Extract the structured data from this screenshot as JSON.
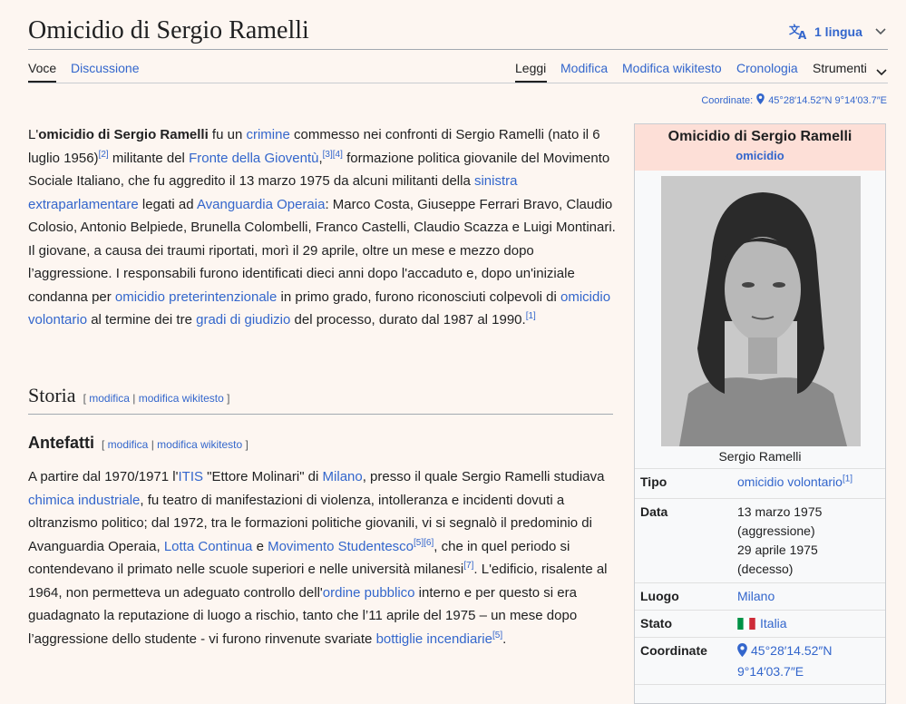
{
  "page": {
    "title": "Omicidio di Sergio Ramelli",
    "language_button": "1 lingua",
    "colors": {
      "link": "#3366cc",
      "infobox_header": "#fddfd7",
      "background": "#fdf6f1"
    }
  },
  "tabs": {
    "left": [
      "Voce",
      "Discussione"
    ],
    "right": [
      "Leggi",
      "Modifica",
      "Modifica wikitesto",
      "Cronologia",
      "Strumenti"
    ]
  },
  "coordinates_line": {
    "label": "Coordinate:",
    "value": "45°28′14.52″N 9°14′03.7″E"
  },
  "intro": {
    "t1": "L'",
    "bold": "omicidio di Sergio Ramelli",
    "t2": " fu un ",
    "l1": "crimine",
    "t3": " commesso nei confronti di Sergio Ramelli (nato il 6 luglio 1956)",
    "r1": "[2]",
    "t4": " militante del ",
    "l2": "Fronte della Gioventù",
    "t4b": ",",
    "r2": "[3][4]",
    "t5": " formazione politica giovanile del Movimento Sociale Italiano, che fu aggredito il 13 marzo 1975 da alcuni militanti della ",
    "l3": "sinistra extraparlamentare",
    "t6": " legati ad ",
    "l4": "Avanguardia Operaia",
    "t7": ": Marco Costa, Giuseppe Ferrari Bravo, Claudio Colosio, Antonio Belpiede, Brunella Colombelli, Franco Castelli, Claudio Scazza e Luigi Montinari. Il giovane, a causa dei traumi riportati, morì il 29 aprile, oltre un mese e mezzo dopo l’aggressione. I responsabili furono identificati dieci anni dopo l'accaduto e, dopo un'iniziale condanna per ",
    "l5": "omicidio preterintenzionale",
    "t8": " in primo grado, furono riconosciuti colpevoli di ",
    "l6": "omicidio volontario",
    "t9": " al termine dei tre ",
    "l7": "gradi di giudizio",
    "t10": " del processo, durato dal 1987 al 1990.",
    "r3": "[1]"
  },
  "sections": {
    "storia": "Storia",
    "antefatti": "Antefatti",
    "edit_open": "[ ",
    "edit_modifica": "modifica",
    "edit_sep": " | ",
    "edit_wikitesto": "modifica wikitesto",
    "edit_close": " ]"
  },
  "body": {
    "t1": "A partire dal 1970/1971 l'",
    "l1": "ITIS",
    "t2": " \"Ettore Molinari\" di ",
    "l2": "Milano",
    "t3": ", presso il quale Sergio Ramelli studiava ",
    "l3": "chimica industriale",
    "t4": ", fu teatro di manifestazioni di violenza, intolleranza e incidenti dovuti a oltranzismo politico; dal 1972, tra le formazioni politiche giovanili, vi si segnalò il predominio di Avanguardia Operaia, ",
    "l4": "Lotta Continua",
    "t5": " e ",
    "l5": "Movimento Studentesco",
    "r1": "[5][6]",
    "t6": ", che in quel periodo si contendevano il primato nelle scuole superiori e nelle università milanesi",
    "r2": "[7]",
    "t7": ". L'edificio, risalente al 1964, non permetteva un adeguato controllo dell'",
    "l6": "ordine pubblico",
    "t8": " interno e per questo si era guadagnato la reputazione di luogo a rischio, tanto che l’11 aprile del 1975 – un mese dopo l’aggressione dello studente - vi furono rinvenute svariate ",
    "l7": "bottiglie incendiarie",
    "r3": "[5]",
    "t9": "."
  },
  "infobox": {
    "title": "Omicidio di Sergio Ramelli",
    "subtitle": "omicidio",
    "caption": "Sergio Ramelli",
    "rows": [
      {
        "key": "Tipo",
        "value": "omicidio volontario",
        "ref": "[1]"
      },
      {
        "key": "Data",
        "line1": "13 marzo 1975",
        "line2": "(aggressione)",
        "line3": "29 aprile 1975",
        "line4": "(decesso)"
      },
      {
        "key": "Luogo",
        "value": "Milano"
      },
      {
        "key": "Stato",
        "value": "Italia"
      },
      {
        "key": "Coordinate",
        "line1": "45°28′14.52″N",
        "line2": "9°14′03.7″E"
      }
    ]
  }
}
